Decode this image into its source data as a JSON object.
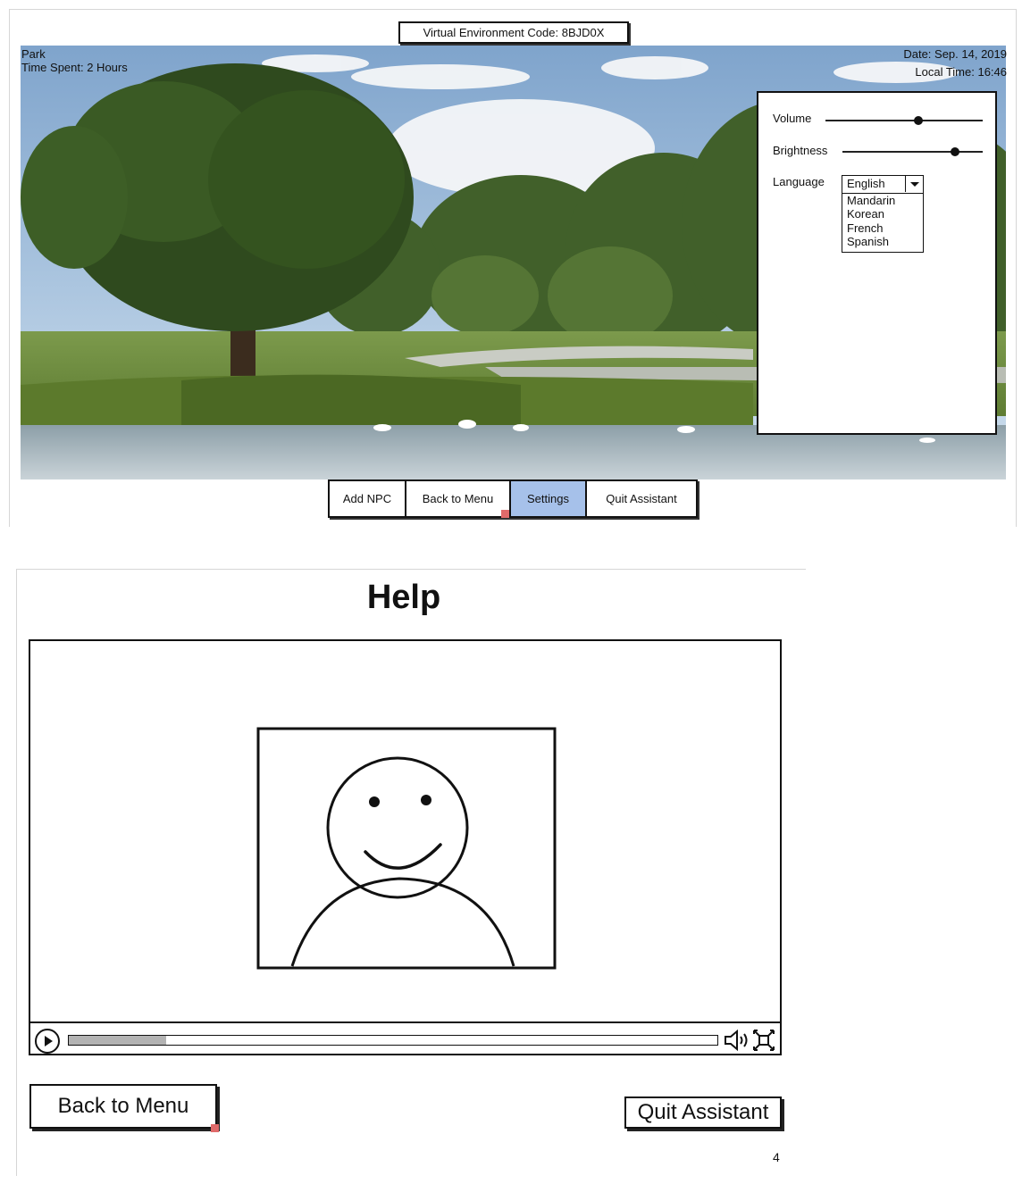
{
  "top_screen": {
    "env_code": "Virtual Environment Code: 8BJD0X",
    "location": "Park",
    "time_spent": "Time Spent: 2 Hours",
    "date": "Date: Sep. 14, 2019",
    "local_time": "Local Time: 16:46",
    "settings": {
      "volume_label": "Volume",
      "volume_level": 0.59,
      "brightness_label": "Brightness",
      "brightness_level": 0.8,
      "language_label": "Language",
      "language_selected": "English",
      "language_options": [
        "Mandarin",
        "Korean",
        "French",
        "Spanish"
      ]
    },
    "nav": {
      "add_npc": "Add NPC",
      "back_to_menu": "Back to Menu",
      "settings": "Settings",
      "quit_assistant": "Quit Assistant",
      "active": "settings",
      "active_color": "#a6c1ea"
    }
  },
  "help_screen": {
    "title": "Help",
    "video": {
      "progress": 0.15,
      "play_icon": "play-icon",
      "volume_icon": "volume-icon",
      "fullscreen_icon": "fullscreen-icon"
    },
    "back_to_menu": "Back to Menu",
    "quit_assistant": "Quit Assistant",
    "page_number": "4"
  }
}
